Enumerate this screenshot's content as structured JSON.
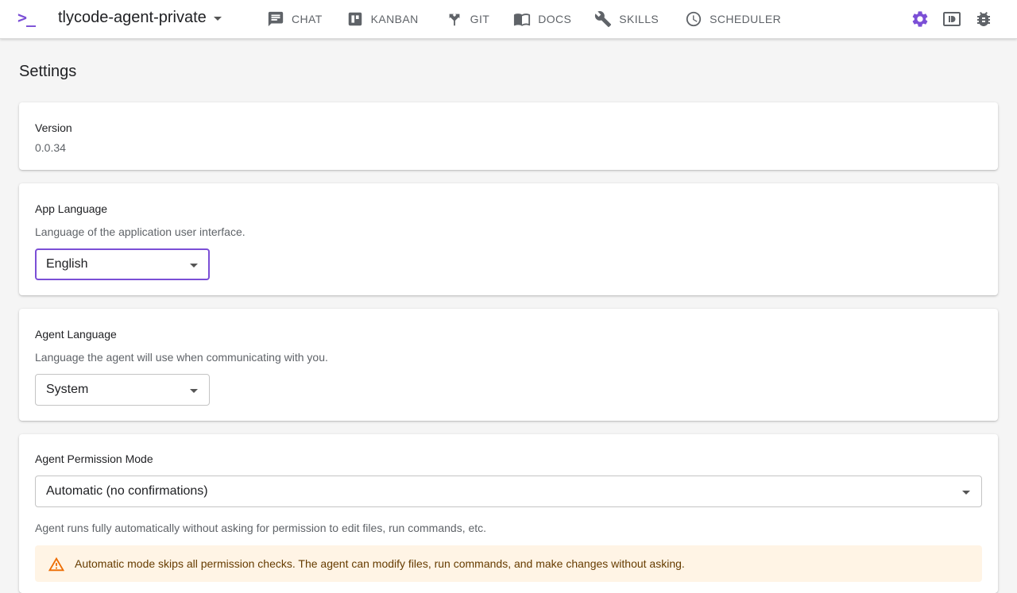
{
  "header": {
    "logo": ">_",
    "project_name": "tlycode-agent-private",
    "nav": [
      {
        "label": "CHAT",
        "icon": "chat-icon"
      },
      {
        "label": "KANBAN",
        "icon": "kanban-icon"
      },
      {
        "label": "GIT",
        "icon": "git-icon"
      },
      {
        "label": "DOCS",
        "icon": "docs-icon"
      },
      {
        "label": "SKILLS",
        "icon": "wrench-icon"
      },
      {
        "label": "SCHEDULER",
        "icon": "clock-icon"
      }
    ],
    "right_icons": [
      "gear-icon",
      "preview-icon",
      "bug-icon"
    ]
  },
  "page": {
    "title": "Settings"
  },
  "version": {
    "label": "Version",
    "value": "0.0.34"
  },
  "app_language": {
    "label": "App Language",
    "description": "Language of the application user interface.",
    "selected": "English"
  },
  "agent_language": {
    "label": "Agent Language",
    "description": "Language the agent will use when communicating with you.",
    "selected": "System"
  },
  "permission_mode": {
    "label": "Agent Permission Mode",
    "selected": "Automatic (no confirmations)",
    "description": "Agent runs fully automatically without asking for permission to edit files, run commands, etc.",
    "warning": "Automatic mode skips all permission checks. The agent can modify files, run commands, and make changes without asking."
  },
  "colors": {
    "accent": "#7b4fd6",
    "warning_bg": "#fff4e5",
    "warning_icon": "#ed6c02"
  }
}
